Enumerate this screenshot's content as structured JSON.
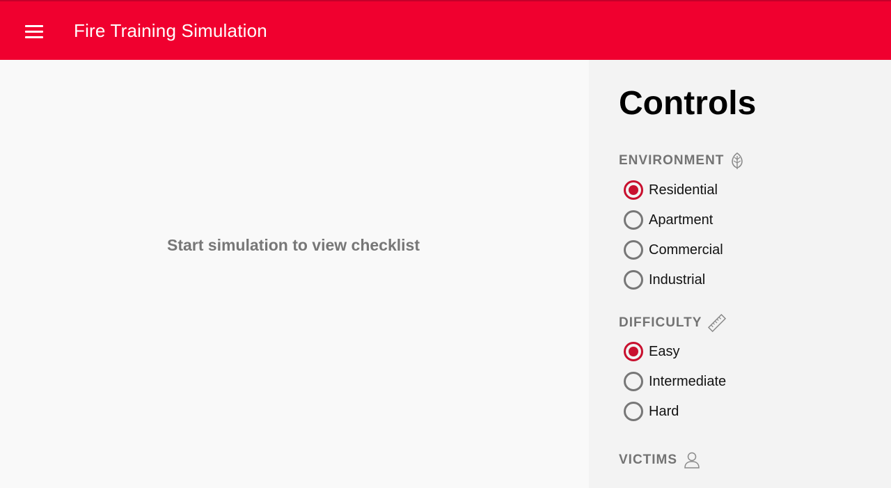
{
  "app": {
    "title": "Fire Training Simulation",
    "brand_color": "#f0002f",
    "accent_color": "#c8102e"
  },
  "main": {
    "placeholder": "Start simulation to view checklist"
  },
  "controls": {
    "title": "Controls",
    "environment": {
      "label": "ENVIRONMENT",
      "icon": "leaf-icon",
      "selected": "Residential",
      "options": [
        "Residential",
        "Apartment",
        "Commercial",
        "Industrial"
      ]
    },
    "difficulty": {
      "label": "DIFFICULTY",
      "icon": "ruler-icon",
      "selected": "Easy",
      "options": [
        "Easy",
        "Intermediate",
        "Hard"
      ]
    },
    "victims": {
      "label": "VICTIMS",
      "icon": "person-icon"
    }
  }
}
